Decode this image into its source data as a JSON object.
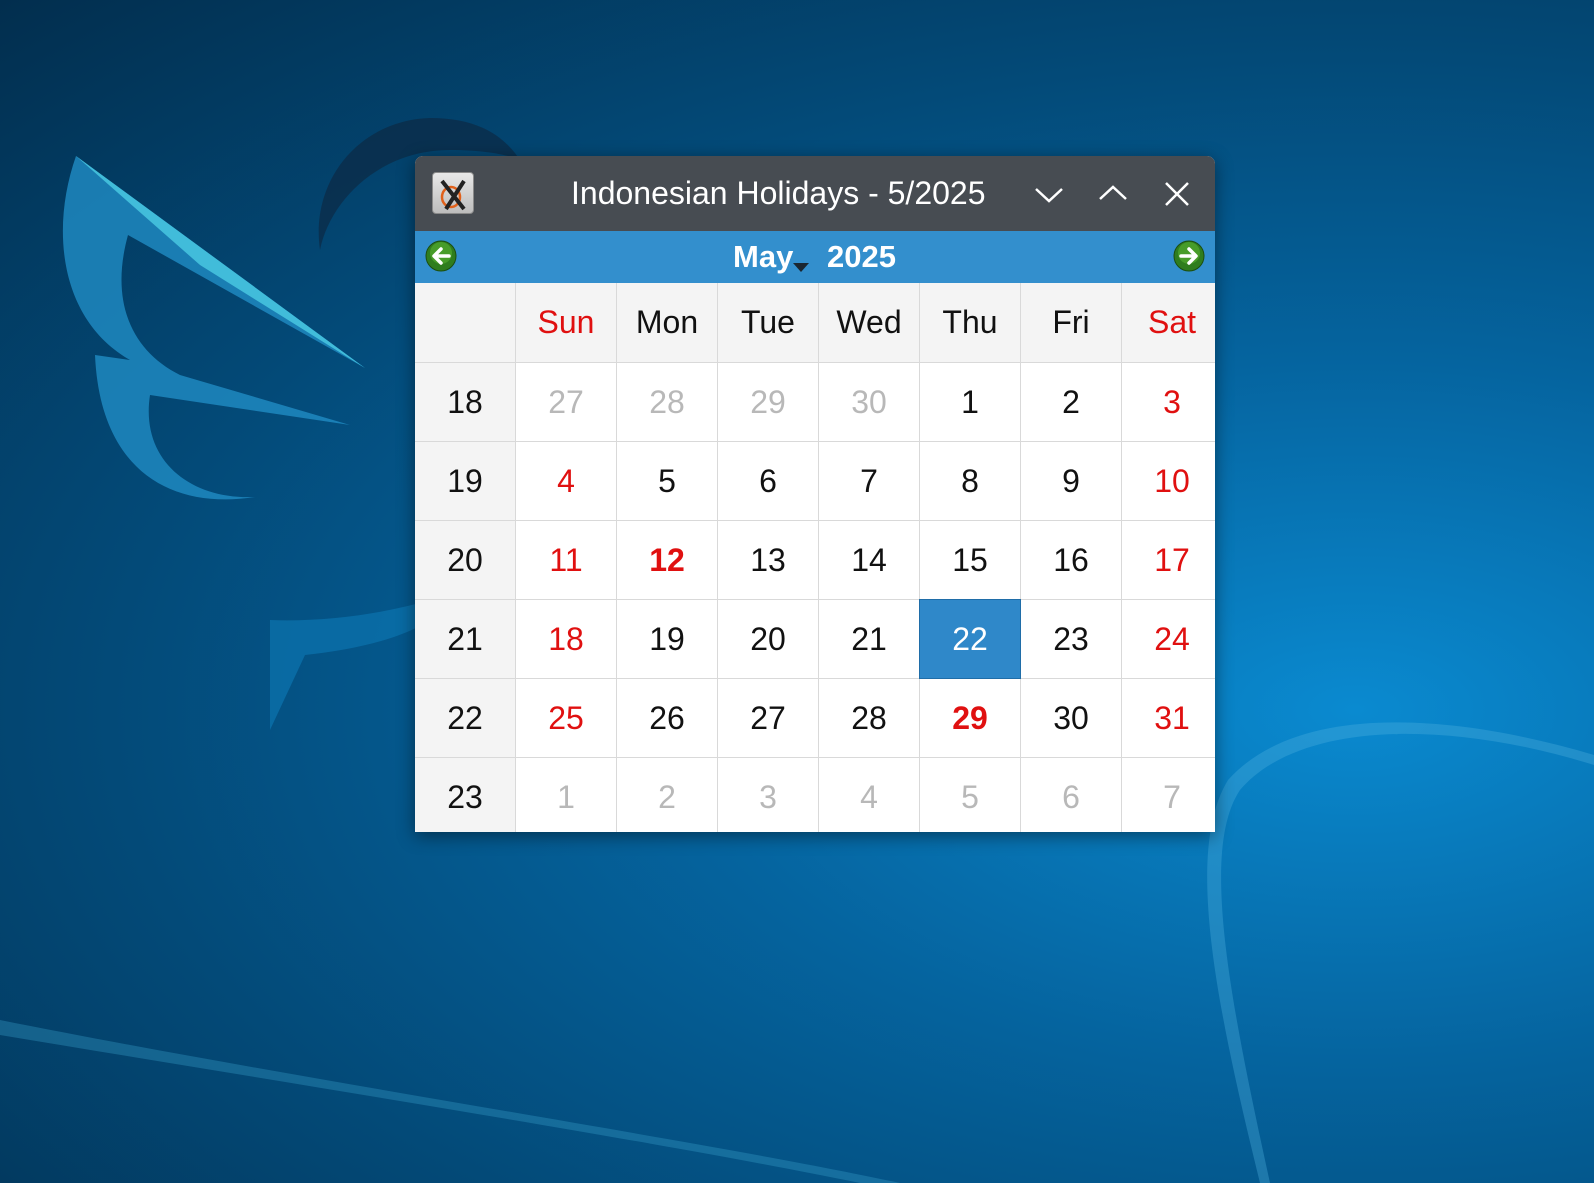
{
  "window": {
    "title": "Indonesian Holidays - 5/2025",
    "app_icon": "x-app-icon"
  },
  "window_controls": {
    "minimize_icon": "chevron-down-icon",
    "maximize_icon": "chevron-up-icon",
    "close_icon": "close-icon"
  },
  "navigation": {
    "month": "May",
    "year": "2025",
    "prev_icon": "arrow-left-circle-icon",
    "next_icon": "arrow-right-circle-icon"
  },
  "weekdays": [
    {
      "label": "Sun",
      "weekend": true
    },
    {
      "label": "Mon",
      "weekend": false
    },
    {
      "label": "Tue",
      "weekend": false
    },
    {
      "label": "Wed",
      "weekend": false
    },
    {
      "label": "Thu",
      "weekend": false
    },
    {
      "label": "Fri",
      "weekend": false
    },
    {
      "label": "Sat",
      "weekend": true
    }
  ],
  "weeks": [
    {
      "week": "18",
      "days": [
        {
          "d": "27",
          "state": "other"
        },
        {
          "d": "28",
          "state": "other"
        },
        {
          "d": "29",
          "state": "other"
        },
        {
          "d": "30",
          "state": "other"
        },
        {
          "d": "1",
          "state": "normal"
        },
        {
          "d": "2",
          "state": "normal"
        },
        {
          "d": "3",
          "state": "weekend"
        }
      ]
    },
    {
      "week": "19",
      "days": [
        {
          "d": "4",
          "state": "weekend"
        },
        {
          "d": "5",
          "state": "normal"
        },
        {
          "d": "6",
          "state": "normal"
        },
        {
          "d": "7",
          "state": "normal"
        },
        {
          "d": "8",
          "state": "normal"
        },
        {
          "d": "9",
          "state": "normal"
        },
        {
          "d": "10",
          "state": "weekend"
        }
      ]
    },
    {
      "week": "20",
      "days": [
        {
          "d": "11",
          "state": "weekend"
        },
        {
          "d": "12",
          "state": "holiday"
        },
        {
          "d": "13",
          "state": "normal"
        },
        {
          "d": "14",
          "state": "normal"
        },
        {
          "d": "15",
          "state": "normal"
        },
        {
          "d": "16",
          "state": "normal"
        },
        {
          "d": "17",
          "state": "weekend"
        }
      ]
    },
    {
      "week": "21",
      "days": [
        {
          "d": "18",
          "state": "weekend"
        },
        {
          "d": "19",
          "state": "normal"
        },
        {
          "d": "20",
          "state": "normal"
        },
        {
          "d": "21",
          "state": "normal"
        },
        {
          "d": "22",
          "state": "selected"
        },
        {
          "d": "23",
          "state": "normal"
        },
        {
          "d": "24",
          "state": "weekend"
        }
      ]
    },
    {
      "week": "22",
      "days": [
        {
          "d": "25",
          "state": "weekend"
        },
        {
          "d": "26",
          "state": "normal"
        },
        {
          "d": "27",
          "state": "normal"
        },
        {
          "d": "28",
          "state": "normal"
        },
        {
          "d": "29",
          "state": "holiday"
        },
        {
          "d": "30",
          "state": "normal"
        },
        {
          "d": "31",
          "state": "weekend"
        }
      ]
    },
    {
      "week": "23",
      "days": [
        {
          "d": "1",
          "state": "other"
        },
        {
          "d": "2",
          "state": "other"
        },
        {
          "d": "3",
          "state": "other"
        },
        {
          "d": "4",
          "state": "other"
        },
        {
          "d": "5",
          "state": "other"
        },
        {
          "d": "6",
          "state": "other"
        },
        {
          "d": "7",
          "state": "other"
        }
      ]
    }
  ],
  "colors": {
    "titlebar": "#474c52",
    "nav_bar": "#338fcd",
    "weekend_red": "#e01010",
    "selected_bg": "#2f88c9",
    "other_month_gray": "#b8b8b8"
  }
}
